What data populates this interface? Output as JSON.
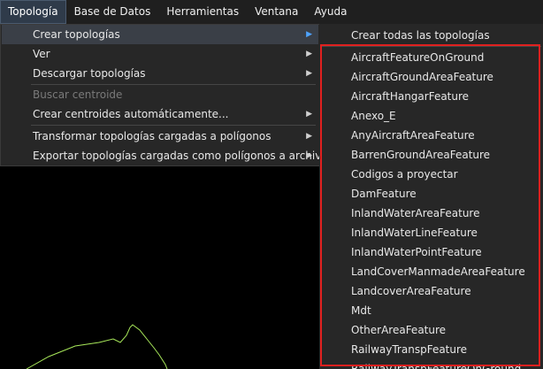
{
  "menubar": {
    "items": [
      "Topología",
      "Base de Datos",
      "Herramientas",
      "Ventana",
      "Ayuda"
    ]
  },
  "topologia_menu": {
    "items": [
      {
        "label": "Crear topologías",
        "arrow": "▶"
      },
      {
        "label": "Ver",
        "arrow": "▶"
      },
      {
        "label": "Descargar topologías",
        "arrow": "▶"
      },
      {
        "label": "Buscar centroide"
      },
      {
        "label": "Crear centroides automáticamente...",
        "arrow": "▶"
      },
      {
        "label": "Transformar topologías cargadas a polígonos",
        "arrow": "▶"
      },
      {
        "label": "Exportar topologías cargadas como polígonos a archivo",
        "arrow": "▶"
      }
    ]
  },
  "submenu": {
    "header": "Crear todas las topologías",
    "items": [
      "AircraftFeatureOnGround",
      "AircraftGroundAreaFeature",
      "AircraftHangarFeature",
      "Anexo_E",
      "AnyAircraftAreaFeature",
      "BarrenGroundAreaFeature",
      "Codigos a proyectar",
      "DamFeature",
      "InlandWaterAreaFeature",
      "InlandWaterLineFeature",
      "InlandWaterPointFeature",
      "LandCoverManmadeAreaFeature",
      "LandcoverAreaFeature",
      "Mdt",
      "OtherAreaFeature",
      "RailwayTranspFeature",
      "RailwayTranspFeatureOnGround"
    ]
  },
  "colors": {
    "menu_bg": "#272727",
    "highlight_bg": "#3a3f47",
    "accent_arrow": "#4ea3ff",
    "annotation_border": "#e0201f",
    "map_line": "#a8e85a"
  }
}
